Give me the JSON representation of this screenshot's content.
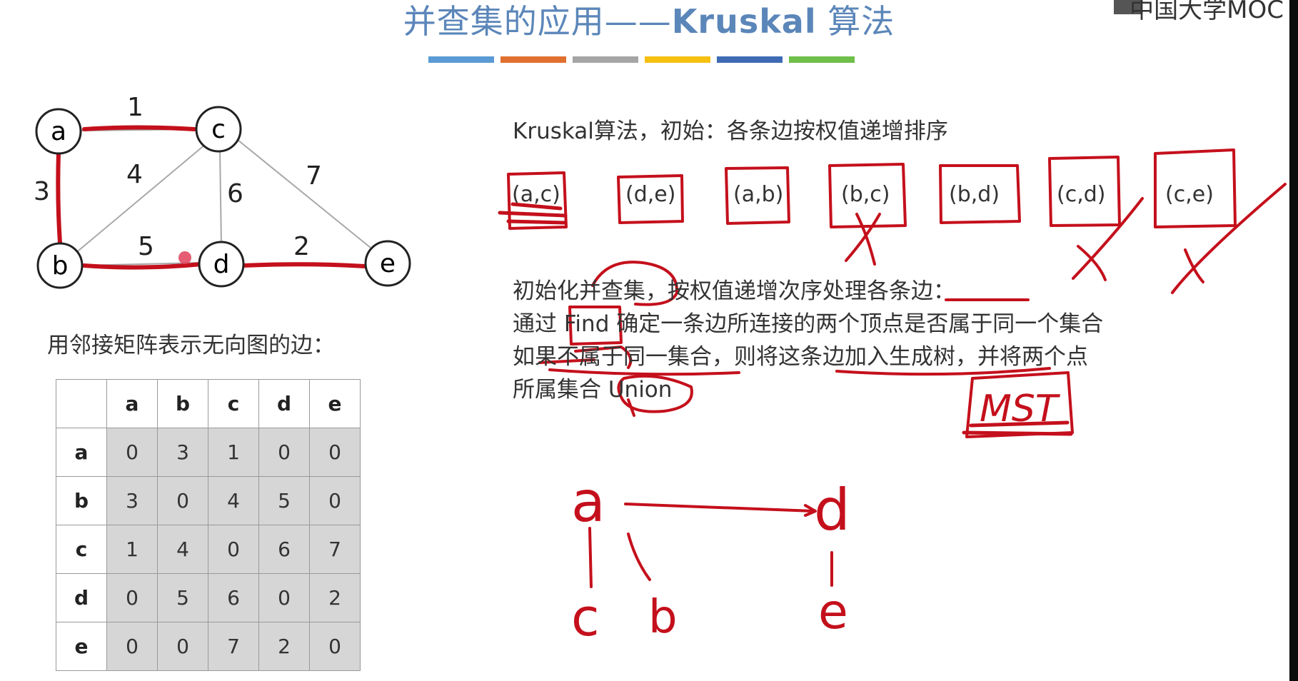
{
  "header": {
    "title_cn": "并查集的应用——",
    "title_kruskal": "Kruskal",
    "title_suffix": " 算法",
    "logo_text": "中国大学MOC"
  },
  "color_bars": [
    "#5b9bd5",
    "#e07030",
    "#a5a5a5",
    "#f5c010",
    "#3e6bb4",
    "#6fbf4a"
  ],
  "graph": {
    "vertices": [
      "a",
      "c",
      "b",
      "d",
      "e"
    ],
    "edges": [
      {
        "from": "a",
        "to": "c",
        "weight": "1"
      },
      {
        "from": "a",
        "to": "b",
        "weight": "3"
      },
      {
        "from": "b",
        "to": "c",
        "weight": "4"
      },
      {
        "from": "c",
        "to": "d",
        "weight": "6"
      },
      {
        "from": "c",
        "to": "e",
        "weight": "7"
      },
      {
        "from": "b",
        "to": "d",
        "weight": "5"
      },
      {
        "from": "d",
        "to": "e",
        "weight": "2"
      }
    ]
  },
  "matrix": {
    "caption": "用邻接矩阵表示无向图的边：",
    "headers": [
      "a",
      "b",
      "c",
      "d",
      "e"
    ],
    "rows": [
      {
        "label": "a",
        "values": [
          "0",
          "3",
          "1",
          "0",
          "0"
        ]
      },
      {
        "label": "b",
        "values": [
          "3",
          "0",
          "4",
          "5",
          "0"
        ]
      },
      {
        "label": "c",
        "values": [
          "1",
          "4",
          "0",
          "6",
          "7"
        ]
      },
      {
        "label": "d",
        "values": [
          "0",
          "5",
          "6",
          "0",
          "2"
        ]
      },
      {
        "label": "e",
        "values": [
          "0",
          "0",
          "7",
          "2",
          "0"
        ]
      }
    ]
  },
  "algorithm": {
    "line1": "Kruskal算法，初始：各条边按权值递增排序",
    "sorted_edges": [
      "(a,c)",
      "(d,e)",
      "(a,b)",
      "(b,c)",
      "(b,d)",
      "(c,d)",
      "(c,e)"
    ],
    "line2": "初始化并查集，按权值递增次序处理各条边：",
    "line3": "通过 Find 确定一条边所连接的两个顶点是否属于同一个集合",
    "line4": "如果不属于同一集合，则将这条边加入生成树，并将两个点",
    "line5": "所属集合 Union"
  },
  "handwriting": {
    "mst_label": "MST",
    "tree_nodes": [
      "a",
      "d",
      "c",
      "b",
      "e"
    ]
  }
}
